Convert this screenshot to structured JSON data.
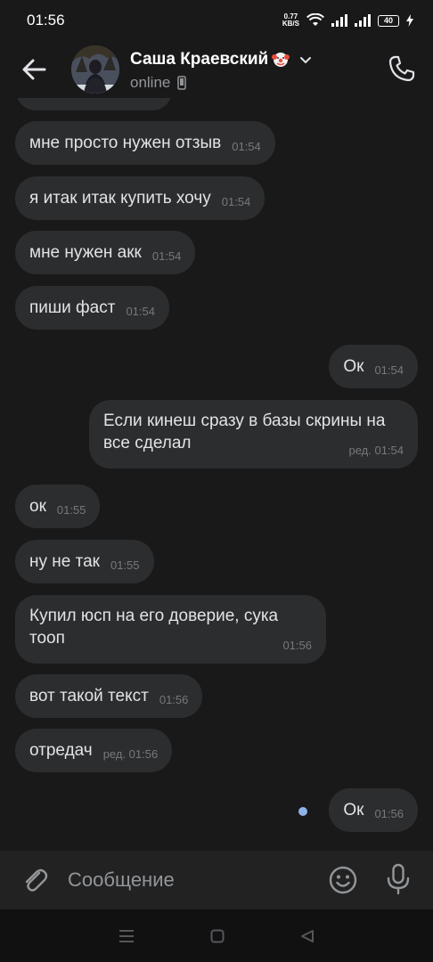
{
  "status_bar": {
    "time": "01:56",
    "net_speed": "0.77",
    "net_unit": "KB/S",
    "battery": "40"
  },
  "header": {
    "contact_name": "Саша Краевский",
    "status": "online"
  },
  "messages": [
    {
      "dir": "in",
      "text": "мне просто нужен отзыв",
      "time": "01:54"
    },
    {
      "dir": "in",
      "text": "я итак итак купить хочу",
      "time": "01:54"
    },
    {
      "dir": "in",
      "text": "мне нужен акк",
      "time": "01:54"
    },
    {
      "dir": "in",
      "text": "пиши фаст",
      "time": "01:54"
    },
    {
      "dir": "out",
      "text": "Ок",
      "time": "01:54"
    },
    {
      "dir": "out",
      "text": "Если кинеш сразу в базы скрины на все сделал",
      "time": "ред. 01:54"
    },
    {
      "dir": "in",
      "text": "ок",
      "time": "01:55"
    },
    {
      "dir": "in",
      "text": "ну не так",
      "time": "01:55"
    },
    {
      "dir": "in",
      "text": "Купил юсп на его доверие, сука тооп",
      "time": "01:56"
    },
    {
      "dir": "in",
      "text": "вот такой текст",
      "time": "01:56"
    },
    {
      "dir": "in",
      "text": "отредач",
      "time": "ред. 01:56"
    },
    {
      "dir": "out",
      "text": "Ок",
      "time": "01:56"
    }
  ],
  "composer": {
    "placeholder": "Сообщение"
  },
  "icons": {
    "back": "arrow-left-icon",
    "phone": "phone-icon",
    "attach": "paperclip-icon",
    "emoji": "smile-icon",
    "mic": "microphone-icon"
  },
  "colors": {
    "background": "#19191a",
    "bubble": "#2c2d2e",
    "unread_dot": "#8fb3e8"
  }
}
